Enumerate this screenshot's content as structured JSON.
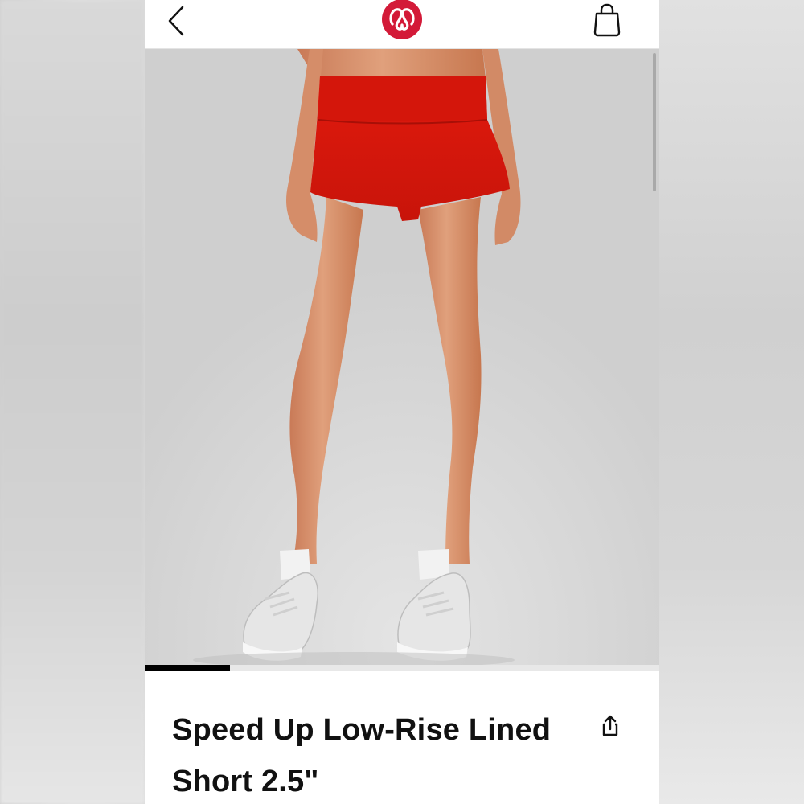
{
  "header": {
    "back_icon": "chevron-left-icon",
    "logo_icon": "lululemon-logo-icon",
    "bag_icon": "shopping-bag-icon",
    "brand_color": "#d31a38"
  },
  "gallery": {
    "image_description_icon": "product-photo",
    "carousel_progress": 0.166
  },
  "product": {
    "title": "Speed Up Low-Rise Lined Short 2.5\"",
    "share_icon": "share-icon"
  }
}
